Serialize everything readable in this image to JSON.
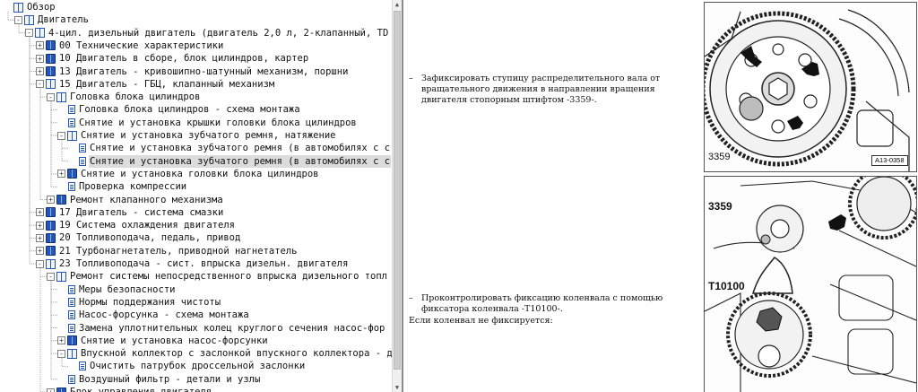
{
  "tree": {
    "items": [
      {
        "label": "Обзор",
        "icon": "book-open",
        "toggle": "",
        "level": 0
      },
      {
        "label": "Двигатель",
        "icon": "book-open",
        "toggle": "-",
        "level": 1
      },
      {
        "label": "4-цил. дизельный двигатель (двигатель 2,0 л, 2-клапанный, TD",
        "icon": "book-open",
        "toggle": "-",
        "level": 2
      },
      {
        "label": "00 Технические характеристики",
        "icon": "book",
        "toggle": "+",
        "level": 3
      },
      {
        "label": "10 Двигатель в сборе, блок цилиндров, картер",
        "icon": "book",
        "toggle": "+",
        "level": 3
      },
      {
        "label": "13 Двигатель - кривошипно-шатунный механизм, поршни",
        "icon": "book",
        "toggle": "+",
        "level": 3
      },
      {
        "label": "15 Двигатель - ГБЦ, клапанный механизм",
        "icon": "book-open",
        "toggle": "-",
        "level": 3
      },
      {
        "label": "Головка блока цилиндров",
        "icon": "book-open",
        "toggle": "-",
        "level": 4
      },
      {
        "label": "Головка блока цилиндров - схема монтажа",
        "icon": "doc",
        "toggle": "",
        "level": 5
      },
      {
        "label": "Снятие и установка крышки головки блока цилиндров",
        "icon": "doc",
        "toggle": "",
        "level": 5
      },
      {
        "label": "Снятие и установка зубчатого ремня, натяжение",
        "icon": "book-open",
        "toggle": "-",
        "level": 5
      },
      {
        "label": "Снятие и установка зубчатого ремня (в автомобилях с с",
        "icon": "doc",
        "toggle": "",
        "level": 6
      },
      {
        "label": "Снятие и установка зубчатого ремня (в автомобилях с с",
        "icon": "doc",
        "toggle": "",
        "level": 6,
        "selected": true
      },
      {
        "label": "Снятие и установка головки блока цилиндров",
        "icon": "book",
        "toggle": "+",
        "level": 5
      },
      {
        "label": "Проверка компрессии",
        "icon": "doc",
        "toggle": "",
        "level": 5
      },
      {
        "label": "Ремонт клапанного механизма",
        "icon": "book",
        "toggle": "+",
        "level": 4
      },
      {
        "label": "17 Двигатель - система смазки",
        "icon": "book",
        "toggle": "+",
        "level": 3
      },
      {
        "label": "19 Система охлаждения двигателя",
        "icon": "book",
        "toggle": "+",
        "level": 3
      },
      {
        "label": "20 Топливоподача, педаль, привод",
        "icon": "book",
        "toggle": "+",
        "level": 3
      },
      {
        "label": "21 Турбонагнетатель, приводной нагнетатель",
        "icon": "book",
        "toggle": "+",
        "level": 3
      },
      {
        "label": "23 Топливоподача - сист. впрыска дизельн. двигателя",
        "icon": "book-open",
        "toggle": "-",
        "level": 3
      },
      {
        "label": "Ремонт системы непосредственного впрыска дизельного топл",
        "icon": "book-open",
        "toggle": "-",
        "level": 4
      },
      {
        "label": "Меры безопасности",
        "icon": "doc",
        "toggle": "",
        "level": 5
      },
      {
        "label": "Нормы поддержания чистоты",
        "icon": "doc",
        "toggle": "",
        "level": 5
      },
      {
        "label": "Насос-форсунка - схема монтажа",
        "icon": "doc",
        "toggle": "",
        "level": 5
      },
      {
        "label": "Замена уплотнительных колец круглого сечения насос-фор",
        "icon": "doc",
        "toggle": "",
        "level": 5
      },
      {
        "label": "Снятие и установка насос-форсунки",
        "icon": "book",
        "toggle": "+",
        "level": 5
      },
      {
        "label": "Впускной коллектор с заслонкой впускного коллектора - д",
        "icon": "book-open",
        "toggle": "-",
        "level": 5
      },
      {
        "label": "Очистить патрубок дроссельной заслонки",
        "icon": "doc",
        "toggle": "",
        "level": 6
      },
      {
        "label": "Воздушный фильтр - детали и узлы",
        "icon": "doc",
        "toggle": "",
        "level": 5
      },
      {
        "label": "Блок управления двигателя",
        "icon": "book",
        "toggle": "+",
        "level": 4
      }
    ]
  },
  "content": {
    "step1": {
      "dash": "–",
      "text": "Зафиксировать ступицу распределительного вала от вращательного движения в направлении вращения двигателя стопорным штифтом -3359-."
    },
    "step2": {
      "dash": "–",
      "text": "Проконтролировать фиксацию коленвала с помощью фиксатора коленвала -T10100-."
    },
    "note": "Если коленвал не фиксируется:",
    "figure1": {
      "callout": "3359",
      "ref": "A13-0358"
    },
    "figure2": {
      "callout_top": "3359",
      "callout_bottom": "T10100"
    }
  },
  "colors": {
    "accent": "#2456b8",
    "selection": "#dcdcdc",
    "splitter": "#8a8a8a"
  }
}
